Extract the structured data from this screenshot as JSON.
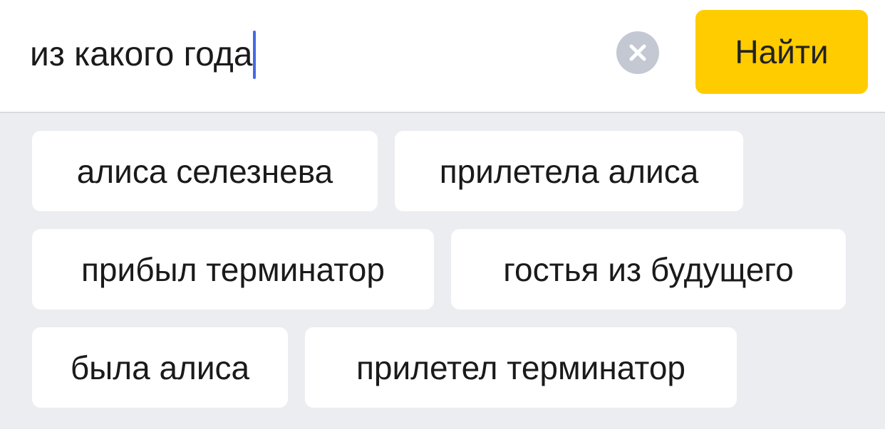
{
  "search": {
    "query": "из какого года",
    "clear_icon": "close-circle-icon",
    "submit_label": "Найти"
  },
  "colors": {
    "accent_button": "#ffcc00",
    "caret": "#4669e6",
    "background": "#ecedf1",
    "chip_background": "#ffffff"
  },
  "suggestions": [
    {
      "label": "алиса селезнева"
    },
    {
      "label": "прилетела алиса"
    },
    {
      "label": "прибыл терминатор"
    },
    {
      "label": "гостья из будущего"
    },
    {
      "label": "была алиса"
    },
    {
      "label": "прилетел терминатор"
    }
  ]
}
